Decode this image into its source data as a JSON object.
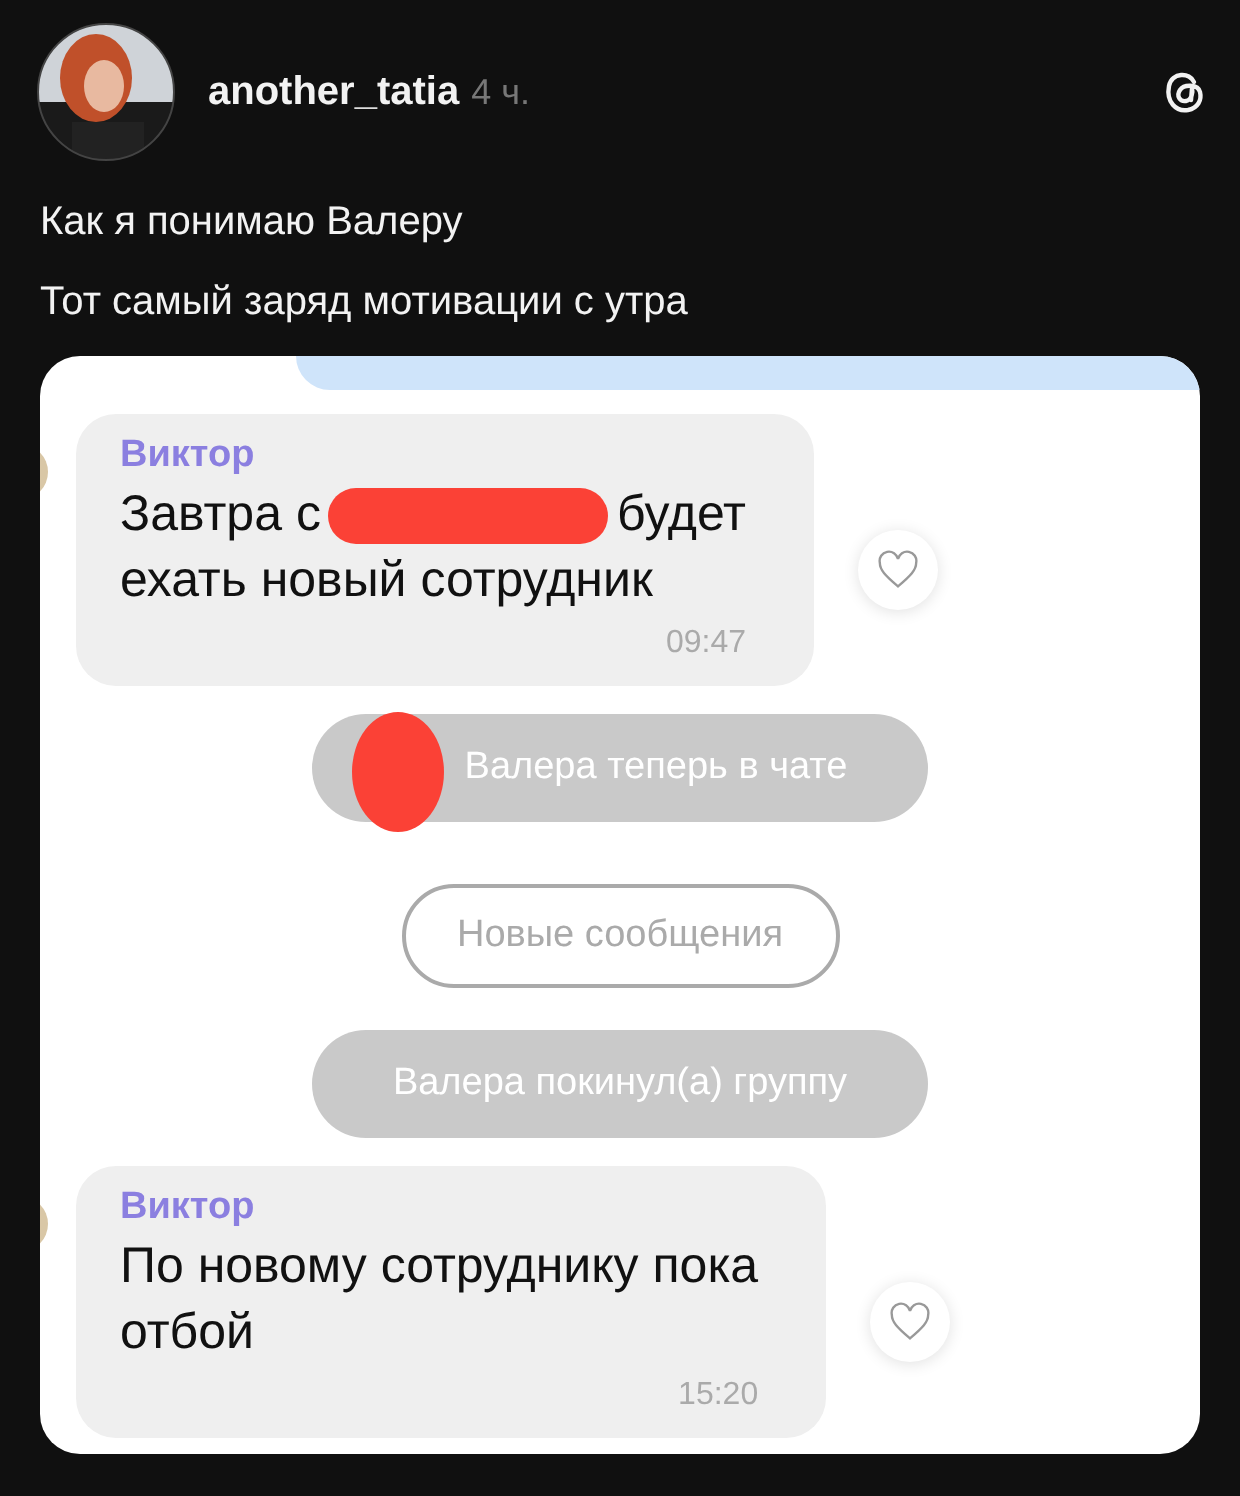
{
  "post": {
    "username": "another_tatia",
    "time": "4 ч.",
    "lines": [
      "Как я понимаю Валеру",
      "Тот самый заряд мотивации с утра"
    ]
  },
  "chat": {
    "messages": [
      {
        "kind": "message",
        "sender": "Виктор",
        "lines": [
          [
            "Завтра с",
            "будет"
          ],
          [
            "ехать новый сотрудник"
          ]
        ],
        "time": "09:47",
        "liked": false
      },
      {
        "kind": "notice",
        "text": "Валера теперь в чате",
        "redacted": true
      },
      {
        "kind": "divider",
        "text": "Новые сообщения"
      },
      {
        "kind": "notice",
        "text": "Валера покинул(а) группу",
        "redacted": false
      },
      {
        "kind": "message",
        "sender": "Виктор",
        "lines": [
          [
            "По новому сотруднику пока"
          ],
          [
            "отбой"
          ]
        ],
        "time": "15:20",
        "liked": false
      }
    ]
  }
}
